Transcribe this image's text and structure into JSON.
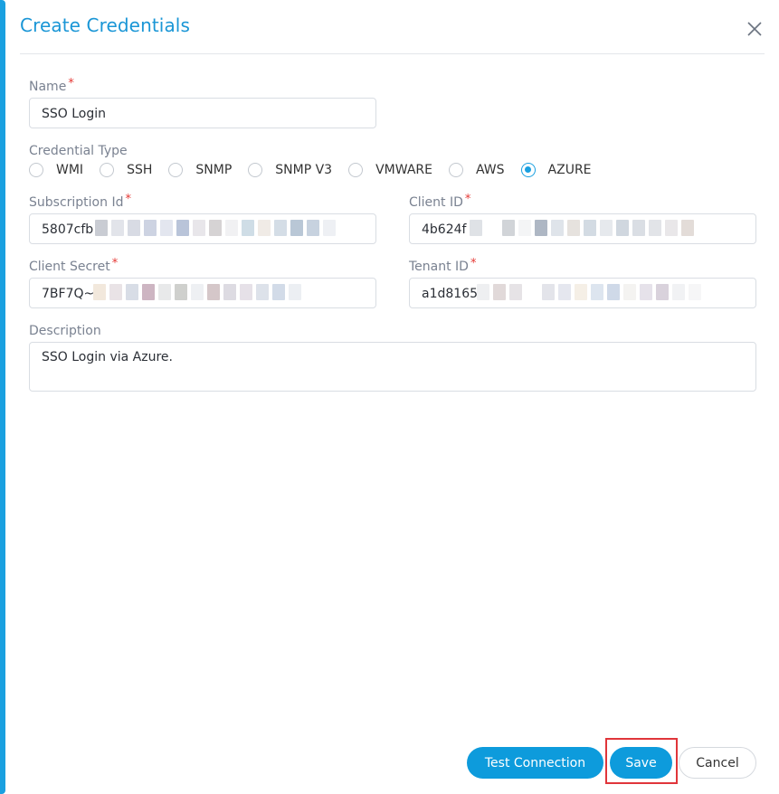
{
  "dialog": {
    "title": "Create Credentials",
    "close_icon": "close-icon"
  },
  "form": {
    "name": {
      "label": "Name",
      "required_mark": "*",
      "value": "SSO Login"
    },
    "credential_type": {
      "label": "Credential Type",
      "options": [
        "WMI",
        "SSH",
        "SNMP",
        "SNMP V3",
        "VMWARE",
        "AWS",
        "AZURE"
      ],
      "selected": "AZURE"
    },
    "subscription_id": {
      "label": "Subscription Id",
      "required_mark": "*",
      "value": "5807cfb"
    },
    "client_id": {
      "label": "Client ID",
      "required_mark": "*",
      "value": "4b624f"
    },
    "client_secret": {
      "label": "Client Secret",
      "required_mark": "*",
      "value": "7BF7Q~"
    },
    "tenant_id": {
      "label": "Tenant ID",
      "required_mark": "*",
      "value": "a1d8165"
    },
    "description": {
      "label": "Description",
      "value": "SSO Login via Azure."
    }
  },
  "footer": {
    "test_connection_label": "Test Connection",
    "save_label": "Save",
    "cancel_label": "Cancel"
  },
  "colors": {
    "accent": "#1a96d6",
    "primary_button": "#0d9bdc",
    "required": "#e53935",
    "highlight": "#e0353a"
  }
}
